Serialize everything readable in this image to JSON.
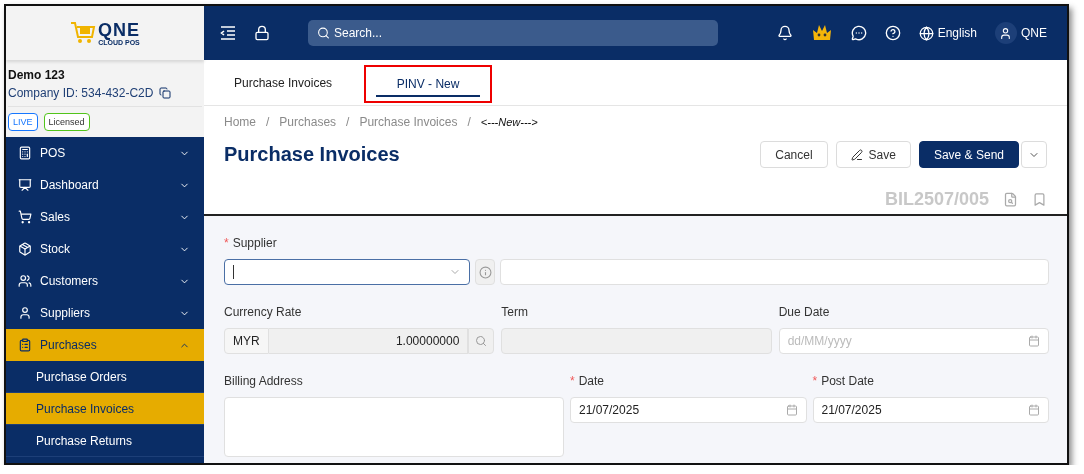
{
  "logo": {
    "name": "QNE",
    "tagline": "CLOUD POS"
  },
  "company": {
    "name": "Demo 123",
    "id": "Company ID: 534-432-C2D",
    "badges": [
      {
        "label": "LIVE",
        "color": "#1677ff"
      },
      {
        "label": "Licensed",
        "color": "#52c41a"
      }
    ]
  },
  "sidebar": {
    "items": [
      {
        "label": "POS",
        "expanded": false,
        "selected": false
      },
      {
        "label": "Dashboard",
        "expanded": false,
        "selected": false
      },
      {
        "label": "Sales",
        "expanded": false,
        "selected": false
      },
      {
        "label": "Stock",
        "expanded": false,
        "selected": false
      },
      {
        "label": "Customers",
        "expanded": false,
        "selected": false
      },
      {
        "label": "Suppliers",
        "expanded": false,
        "selected": false
      },
      {
        "label": "Purchases",
        "expanded": true,
        "selected": true,
        "children": [
          {
            "label": "Purchase Orders",
            "selected": false
          },
          {
            "label": "Purchase Invoices",
            "selected": true
          },
          {
            "label": "Purchase Returns",
            "selected": false
          }
        ]
      }
    ]
  },
  "topbar": {
    "search": {
      "placeholder": "Search..."
    },
    "language": "English",
    "user": "QNE"
  },
  "tabs": [
    {
      "label": "Purchase Invoices",
      "selected": false,
      "highlighted": false
    },
    {
      "label": "PINV - New",
      "selected": true,
      "highlighted": true
    }
  ],
  "breadcrumb": {
    "separator": "/",
    "items": [
      "Home",
      "Purchases",
      "Purchase Invoices",
      "<---New--->"
    ]
  },
  "page": {
    "title": "Purchase Invoices",
    "buttons": [
      "Cancel",
      "Save",
      "Save & Send"
    ],
    "doc_no": "BIL2507/005"
  },
  "form": {
    "supplier": {
      "label": "Supplier",
      "required_mark": "*",
      "focused": true
    },
    "currency_rate": {
      "label": "Currency Rate",
      "currency": "MYR",
      "value": "1.00000000"
    },
    "term": {
      "label": "Term",
      "disabled": true
    },
    "due_date": {
      "label": "Due Date",
      "placeholder": "dd/MM/yyyy"
    },
    "billing_address": {
      "label": "Billing Address"
    },
    "date": {
      "label": "Date",
      "required_mark": "*",
      "value": "21/07/2025"
    },
    "post_date": {
      "label": "Post Date",
      "required_mark": "*",
      "value": "21/07/2025"
    }
  }
}
